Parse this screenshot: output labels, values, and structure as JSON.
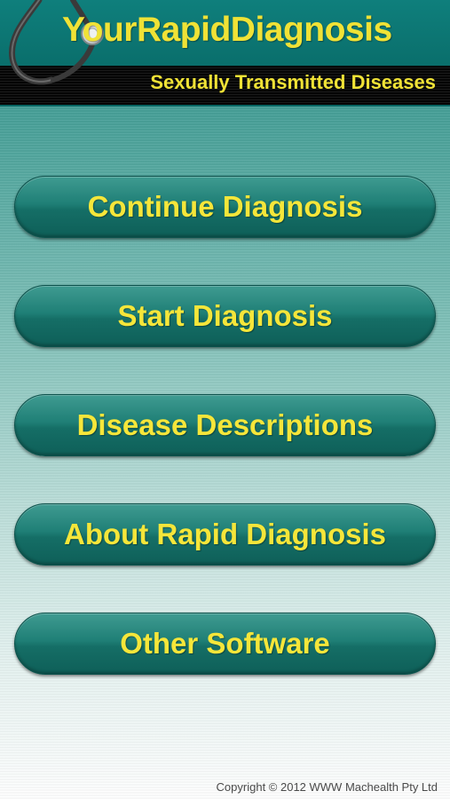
{
  "header": {
    "title": "YourRapidDiagnosis",
    "subtitle": "Sexually Transmitted Diseases",
    "logo_icon": "stethoscope-icon",
    "colors": {
      "title": "#f0e236",
      "header_bg": "#0a6f6c",
      "band_bg": "#111111"
    }
  },
  "menu": {
    "items": [
      {
        "label": "Continue Diagnosis"
      },
      {
        "label": "Start Diagnosis"
      },
      {
        "label": "Disease Descriptions"
      },
      {
        "label": "About Rapid Diagnosis"
      },
      {
        "label": "Other Software"
      }
    ],
    "colors": {
      "button_bg": "#156e66",
      "button_text": "#f5e63a"
    }
  },
  "footer": {
    "copyright": "Copyright © 2012 WWW Machealth Pty Ltd"
  }
}
